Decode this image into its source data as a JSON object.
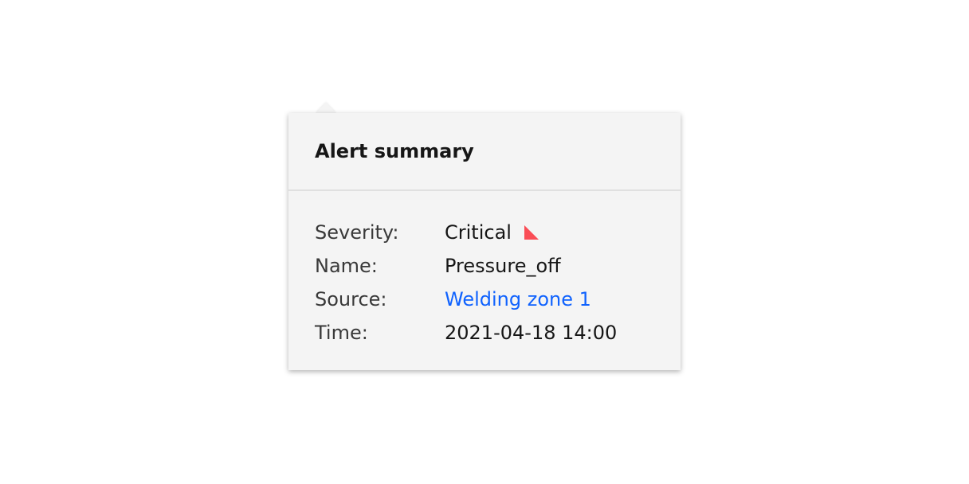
{
  "popover": {
    "title": "Alert summary",
    "fields": [
      {
        "label": "Severity:",
        "value": "Critical",
        "icon": "critical-triangle-icon",
        "icon_color": "#fa4d56"
      },
      {
        "label": "Name:",
        "value": "Pressure_off"
      },
      {
        "label": "Source:",
        "value": "Welding zone 1",
        "link": true,
        "link_color": "#0f62fe"
      },
      {
        "label": "Time:",
        "value": "2021-04-18 14:00"
      }
    ]
  }
}
